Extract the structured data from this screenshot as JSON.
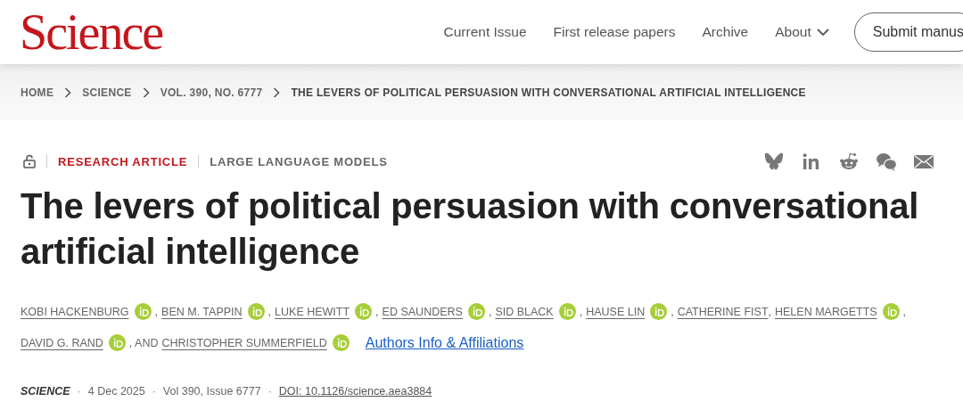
{
  "header": {
    "logo": "Science",
    "nav": [
      {
        "label": "Current Issue",
        "kind": "link"
      },
      {
        "label": "First release papers",
        "kind": "link"
      },
      {
        "label": "Archive",
        "kind": "link"
      },
      {
        "label": "About",
        "kind": "dropdown"
      }
    ],
    "submit_button": "Submit manus"
  },
  "breadcrumbs": [
    {
      "label": "HOME",
      "kind": "link"
    },
    {
      "label": "SCIENCE",
      "kind": "link"
    },
    {
      "label": "VOL. 390, NO. 6777",
      "kind": "link"
    },
    {
      "label": "THE LEVERS OF POLITICAL PERSUASION WITH CONVERSATIONAL ARTIFICIAL INTELLIGENCE",
      "kind": "current"
    }
  ],
  "article": {
    "article_type": "RESEARCH ARTICLE",
    "topic": "LARGE LANGUAGE MODELS",
    "title": "The levers of political persuasion with conversational artificial intelligence",
    "author_lines": [
      [
        {
          "name": "KOBI HACKENBURG",
          "orcid": true,
          "separator": ","
        },
        {
          "name": "BEN M. TAPPIN",
          "orcid": true,
          "separator": ","
        },
        {
          "name": "LUKE HEWITT",
          "orcid": true,
          "separator": ","
        },
        {
          "name": "ED SAUNDERS",
          "orcid": true,
          "separator": ","
        },
        {
          "name": "SID BLACK",
          "orcid": true,
          "separator": ","
        },
        {
          "name": "HAUSE LIN",
          "orcid": true,
          "separator": ","
        },
        {
          "name": "CATHERINE FIST",
          "orcid": false,
          "separator": ","
        },
        {
          "name": "HELEN MARGETTS",
          "orcid": true,
          "separator": ","
        }
      ],
      [
        {
          "name": "DAVID G. RAND",
          "orcid": true,
          "separator": ", AND"
        },
        {
          "name": "CHRISTOPHER SUMMERFIELD",
          "orcid": true
        }
      ]
    ],
    "affiliations_link": "Authors Info & Affiliations",
    "meta": {
      "journal": "SCIENCE",
      "separator": "·",
      "date": "4 Dec 2025",
      "volume": "Vol 390, Issue 6777",
      "doi": "DOI: 10.1126/science.aea3884"
    }
  }
}
